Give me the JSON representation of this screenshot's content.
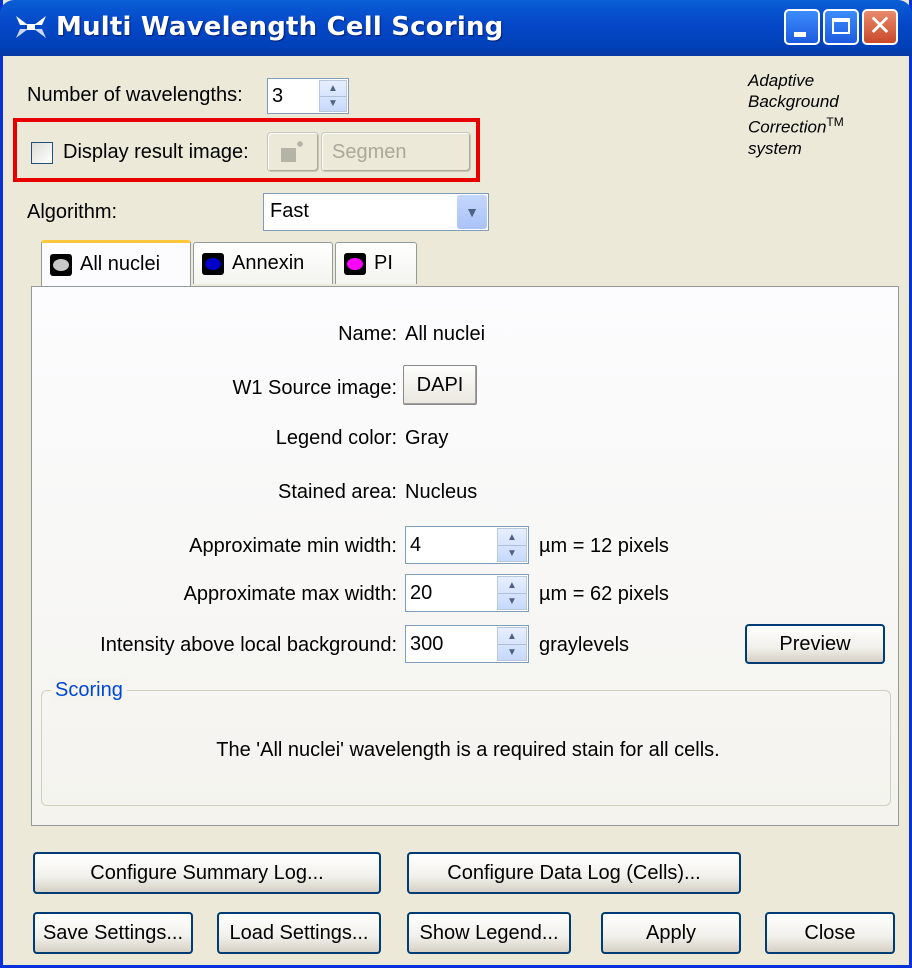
{
  "window": {
    "title": "Multi Wavelength Cell Scoring"
  },
  "header": {
    "wavelengths_label": "Number of wavelengths:",
    "wavelengths_value": "3",
    "display_result_label": "Display result image:",
    "segment_button_label": "Segmen",
    "display_result_checked": false,
    "brand_line1": "Adaptive",
    "brand_line2": "Background",
    "brand_line3": "Correction",
    "brand_tm": "TM",
    "brand_line4": "system",
    "algorithm_label": "Algorithm:",
    "algorithm_value": "Fast"
  },
  "tabs": [
    {
      "label": "All nuclei",
      "color": "#c8c8c8",
      "active": true
    },
    {
      "label": "Annexin",
      "color": "#0000c8",
      "active": false
    },
    {
      "label": "PI",
      "color": "#ff00ff",
      "active": false
    }
  ],
  "panel": {
    "name_label": "Name:",
    "name_value": "All nuclei",
    "source_label": "W1 Source image:",
    "source_value": "DAPI",
    "legend_label": "Legend color:",
    "legend_value": "Gray",
    "stained_label": "Stained area:",
    "stained_value": "Nucleus",
    "min_width_label": "Approximate min width:",
    "min_width_value": "4",
    "min_width_unit": "µm = 12 pixels",
    "max_width_label": "Approximate max width:",
    "max_width_value": "20",
    "max_width_unit": "µm = 62 pixels",
    "intensity_label": "Intensity above local background:",
    "intensity_value": "300",
    "intensity_unit": "graylevels",
    "preview_label": "Preview",
    "scoring_title": "Scoring",
    "scoring_text": "The 'All nuclei' wavelength is a required stain for all cells."
  },
  "footer": {
    "summary_log": "Configure Summary Log...",
    "data_log": "Configure Data Log (Cells)...",
    "save_settings": "Save Settings...",
    "load_settings": "Load Settings...",
    "show_legend": "Show Legend...",
    "apply": "Apply",
    "close": "Close"
  }
}
